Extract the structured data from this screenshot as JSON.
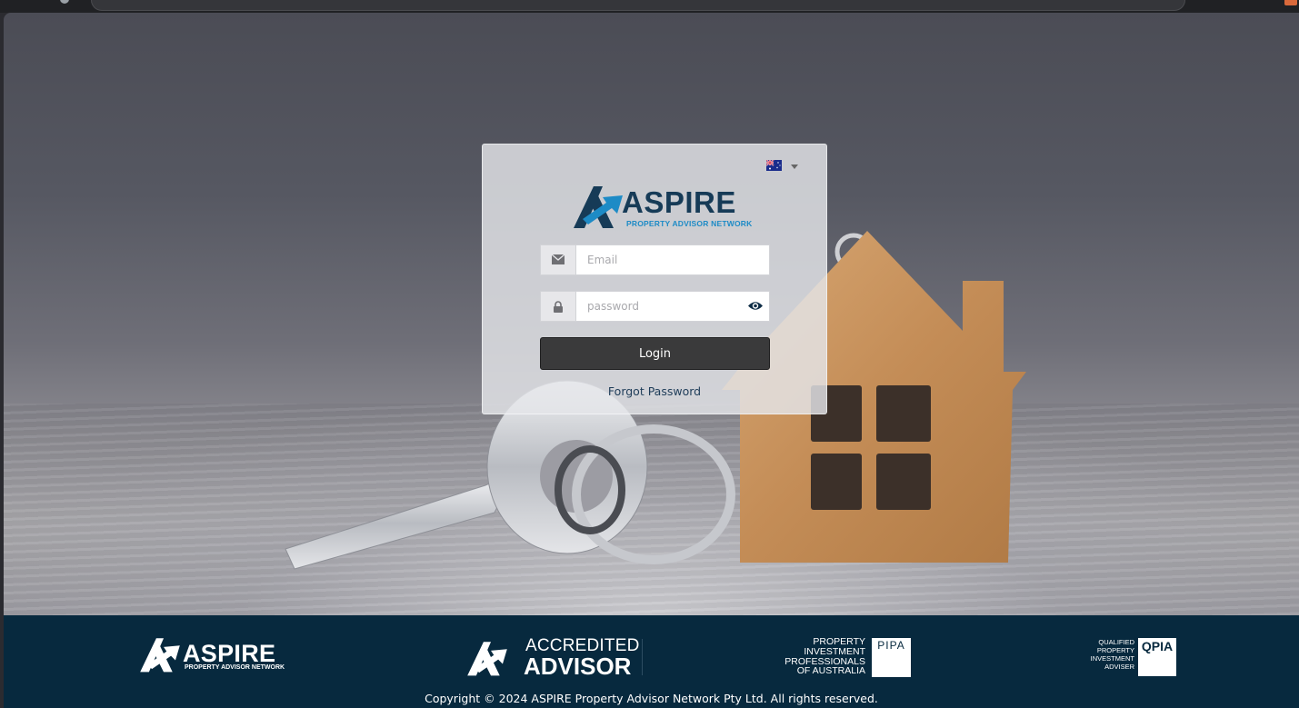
{
  "login": {
    "language": "English (Australia)",
    "brand": {
      "name": "ASPIRE",
      "tagline": "PROPERTY ADVISOR NETWORK"
    },
    "email_placeholder": "Email",
    "password_placeholder": "password",
    "login_label": "Login",
    "forgot_label": "Forgot Password"
  },
  "icons": {
    "email": "envelope-icon",
    "password": "lock-icon",
    "reveal": "eye-icon",
    "language": "australia-flag-icon"
  },
  "colors": {
    "brand_navy": "#163b57",
    "brand_blue": "#1d8bc6",
    "footer_bg": "#07293e",
    "button_bg": "#3a3a3b"
  },
  "footer": {
    "aspire": {
      "name": "ASPIRE",
      "tagline": "PROPERTY ADVISOR NETWORK"
    },
    "accredited": {
      "line1": "ACCREDITED",
      "line2": "ADVISOR"
    },
    "pipa": {
      "lines": [
        "PROPERTY",
        "INVESTMENT",
        "PROFESSIONALS",
        "OF AUSTRALIA"
      ],
      "badge": "PIPA"
    },
    "qpia": {
      "lines": [
        "QUALIFIED",
        "PROPERTY",
        "INVESTMENT",
        "ADVISER"
      ],
      "badge": "QPIA"
    },
    "copyright": "Copyright © 2024 ASPIRE Property Advisor Network Pty Ltd. All rights reserved."
  }
}
